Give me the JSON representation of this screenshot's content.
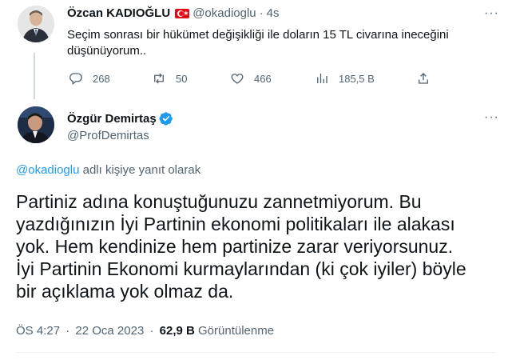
{
  "tweet1": {
    "author_name": "Özcan KADIOĞLU",
    "handle": "@okadioglu",
    "separator": "·",
    "time": "4s",
    "text_line1": "Seçim sonrası bir hükümet değişikliği ile doların 15 TL civarına ineceğini",
    "text_line2": "düşünüyorum..",
    "stats": {
      "replies": "268",
      "retweets": "50",
      "likes": "466",
      "views": "185,5 B"
    },
    "more": "···"
  },
  "tweet2": {
    "author_name": "Özgür Demirtaş",
    "handle": "@ProfDemirtas",
    "reply_mention": "@okadioglu",
    "reply_suffix": " adlı kişiye yanıt olarak",
    "lines": [
      "Partiniz adına konuştuğunuzu zannetmiyorum. Bu",
      "yazdığınızın İyi Partinin ekonomi politikaları ile alakası",
      "yok. Hem kendinize hem partinize zarar veriyorsunuz.",
      "İyi Partinin Ekonomi kurmaylarından (ki çok iyiler) böyle",
      "bir açıklama yok olmaz da."
    ],
    "time": "ÖS 4:27",
    "separator": "·",
    "date": "22 Oca 2023",
    "separator2": "·",
    "views_count": "62,9 B",
    "views_label": " Görüntülenme",
    "more": "···"
  },
  "colors": {
    "accent": "#1d9bf0",
    "muted": "#536471",
    "text": "#0f1419",
    "thread_line": "#cfd9de",
    "flag_red": "#e30a17"
  }
}
